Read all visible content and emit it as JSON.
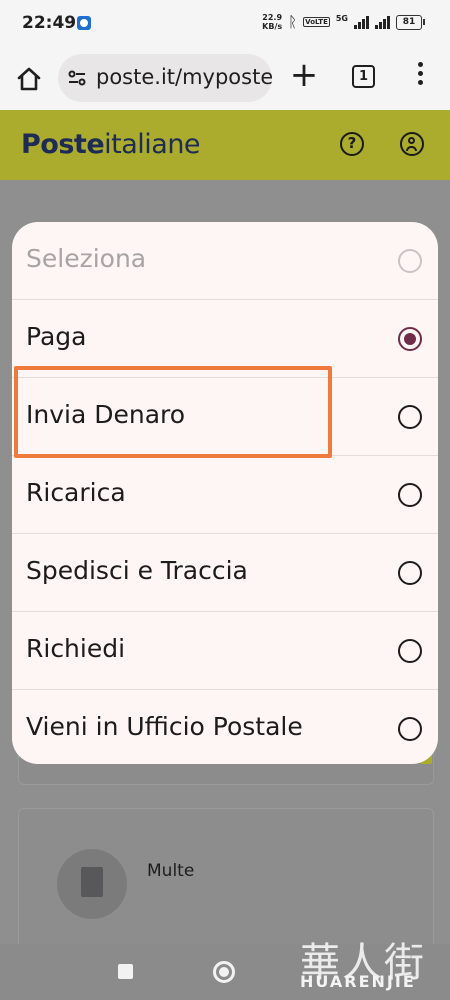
{
  "status_bar": {
    "time": "22:49",
    "net_speed_value": "22.9",
    "net_speed_unit": "KB/s",
    "volte": "VoLTE",
    "network_gen": "5G",
    "battery": "81"
  },
  "browser": {
    "url": "poste.it/myposte/",
    "tab_count": "1"
  },
  "site": {
    "logo_bold": "Poste",
    "logo_light": "italiane",
    "help_symbol": "?"
  },
  "dialog": {
    "placeholder": "Seleziona",
    "options": [
      {
        "label": "Paga",
        "selected": true
      },
      {
        "label": "Invia Denaro",
        "selected": false
      },
      {
        "label": "Ricarica",
        "selected": false
      },
      {
        "label": "Spedisci e Traccia",
        "selected": false
      },
      {
        "label": "Richiedi",
        "selected": false
      },
      {
        "label": "Vieni in Ufficio Postale",
        "selected": false
      }
    ]
  },
  "background": {
    "multe_label": "Multe"
  },
  "annotation": {
    "highlight_color": "#ee7a3e",
    "highlighted_option": "Invia Denaro"
  },
  "watermark": {
    "cjk": "華人街",
    "latin": "HUARENJIE"
  },
  "colors": {
    "brand_yellow": "#ffff00",
    "brand_blue": "#1d2b55",
    "radio_selected": "#6e2d48"
  }
}
